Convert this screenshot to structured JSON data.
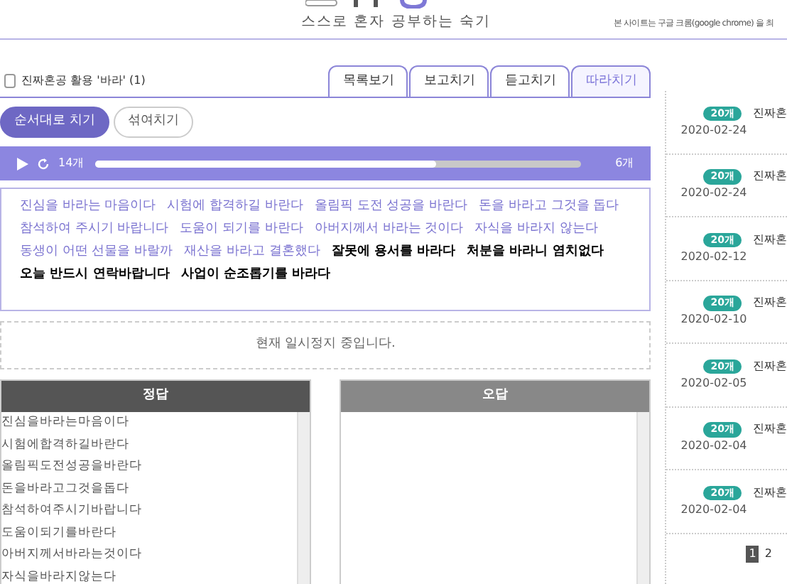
{
  "header": {
    "tagline": "스스로 혼자 공부하는 숙기",
    "notice": "본 사이트는 구글 크롬(google chrome) 을 최"
  },
  "lesson": {
    "title": "진짜혼공 활용 '바라' (1)"
  },
  "tabs": [
    {
      "label": "목록보기",
      "selected": false
    },
    {
      "label": "보고치기",
      "selected": false
    },
    {
      "label": "듣고치기",
      "selected": false
    },
    {
      "label": "따라치기",
      "selected": true
    }
  ],
  "modes": [
    {
      "label": "순서대로 치기",
      "selected": true
    },
    {
      "label": "섞여치기",
      "selected": false
    }
  ],
  "player": {
    "done_count": "14개",
    "level": 0.7,
    "remaining_count": "6개"
  },
  "sentences": [
    {
      "text": "진심을 바라는 마음이다",
      "done": true
    },
    {
      "text": "시험에 합격하길 바란다",
      "done": true
    },
    {
      "text": "올림픽 도전 성공을 바란다",
      "done": true
    },
    {
      "text": "돈을 바라고 그것을 돕다",
      "done": true
    },
    {
      "text": "참석하여 주시기 바랍니다",
      "done": true
    },
    {
      "text": "도움이 되기를 바란다",
      "done": true
    },
    {
      "text": "아버지께서 바라는 것이다",
      "done": true
    },
    {
      "text": "자식을 바라지 않는다",
      "done": true
    },
    {
      "text": "동생이 어떤 선물을 바랄까",
      "done": true
    },
    {
      "text": "재산을 바라고 결혼했다",
      "done": true
    },
    {
      "text": "잘못에 용서를 바라다",
      "done": false
    },
    {
      "text": "처분을 바라니 염치없다",
      "done": false
    },
    {
      "text": "오늘 반드시 연락바랍니다",
      "done": false
    },
    {
      "text": "사업이 순조롭기를 바라다",
      "done": false
    }
  ],
  "status": "현재 일시정지 중입니다.",
  "correct": {
    "title": "정답",
    "items": [
      "진심을바라는마음이다",
      "시험에합격하길바란다",
      "올림픽도전성공을바란다",
      "돈을바라고그것을돕다",
      "참석하여주시기바랍니다",
      "도움이되기를바란다",
      "아버지께서바라는것이다",
      "자식을바라지않는다"
    ]
  },
  "wrong": {
    "title": "오답"
  },
  "sidebar": [
    {
      "badge": "20개",
      "title": "진짜혼",
      "date": "2020-02-24"
    },
    {
      "badge": "20개",
      "title": "진짜혼",
      "date": "2020-02-24"
    },
    {
      "badge": "20개",
      "title": "진짜혼",
      "date": "2020-02-12"
    },
    {
      "badge": "20개",
      "title": "진짜혼",
      "date": "2020-02-10"
    },
    {
      "badge": "20개",
      "title": "진짜혼",
      "date": "2020-02-05"
    },
    {
      "badge": "20개",
      "title": "진짜혼",
      "date": "2020-02-04"
    },
    {
      "badge": "20개",
      "title": "진짜혼",
      "date": "2020-02-04"
    }
  ],
  "pagination": [
    {
      "label": "1",
      "selected": true
    },
    {
      "label": "2",
      "selected": false
    }
  ]
}
